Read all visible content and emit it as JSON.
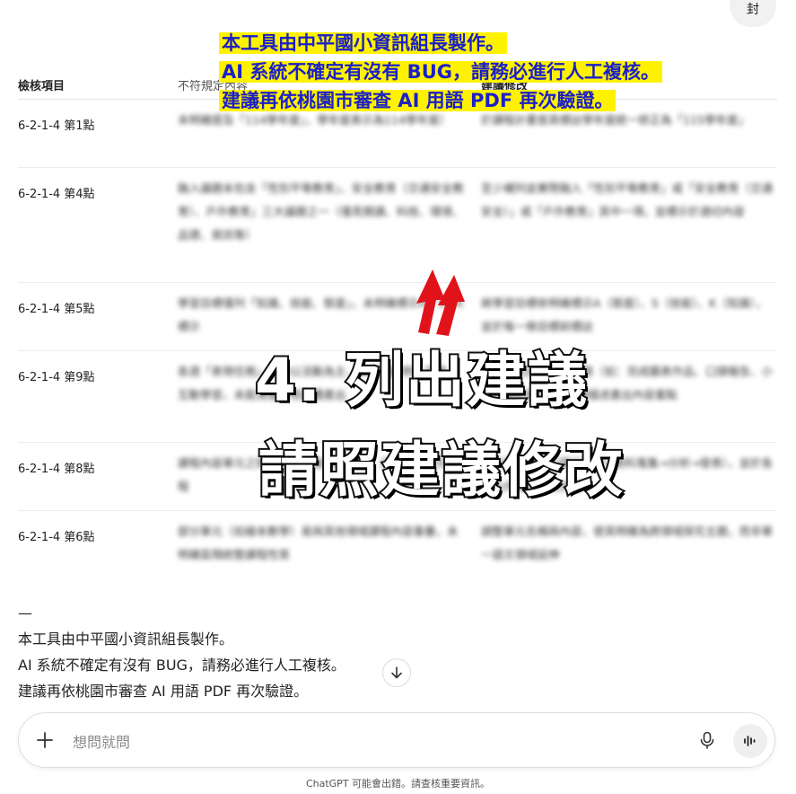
{
  "header": {
    "top_button_label": "封"
  },
  "table": {
    "headers": [
      "檢核項目",
      "不符規定內容",
      "建議修改"
    ],
    "rows": [
      {
        "item": "6-2-1-4 第1點",
        "issue": "未明確提及「114學年度」，學年度表示為114學年度）",
        "suggestion": "於課程計畫首頁標註學年度統一修正為「115學年度」"
      },
      {
        "item": "6-2-1-4 第4點",
        "issue": "融入議題未包含「性別平等教育」、安全教育（交通安全教育）、戶外教育」三大議題之一（僅見閱讀、科技、環境、品德、資訊等）",
        "suggestion": "至少補列並實際融入「性別平等教育」或「安全教育（交通安全）」或「戶外教育」其中一項，並標示於適切內容"
      },
      {
        "item": "6-2-1-4 第5點",
        "issue": "學習目標僅列「知識、技能、態度」，未明確標示A、S、K標示",
        "suggestion": "將學習目標依明確標示A（態度）、S（技能）、K（知識），並於每一條目標前標註"
      },
      {
        "item": "6-2-1-4 第9點",
        "issue": "各週「表現任務」描述以活動為主，未明確說明、評量、互動學習，未能清楚呈現具體產出",
        "suggestion": "每週補充具體表現任務（如：完成圖表作品、口頭報告、小組討論紀錄），並具體描述產出內容重點"
      },
      {
        "item": "6-2-1-4 第8點",
        "issue": "課程內容單元之間的探究歷程說明不足，未能呈現探究歷程",
        "suggestion": "補充探究歷程（提出問題→資料蒐集→分析→發表），並於各單元內標示探究步驟"
      },
      {
        "item": "6-2-1-4 第6點",
        "issue": "部分單元（如繪本數學）易與其他領域課程內容重疊，未明確區隔統整課程性質",
        "suggestion": "調整單元名稱與內容，使其明確為跨領域探究主題，而非單一語文領域延伸"
      }
    ]
  },
  "callout": {
    "lines": [
      "本工具由中平國小資訊組長製作。",
      "AI 系統不確定有沒有 BUG，請務必進行人工複核。",
      "建議再依桃園市審查 AI 用語 PDF 再次驗證。"
    ],
    "big_line1": "4. 列出建議",
    "big_line2": "請照建議修改"
  },
  "message": {
    "divider": "—",
    "lines": [
      "本工具由中平國小資訊組長製作。",
      "AI 系統不確定有沒有 BUG，請務必進行人工複核。",
      "建議再依桃園市審查 AI 用語 PDF 再次驗證。"
    ]
  },
  "composer": {
    "placeholder": "想問就問",
    "plus_icon": "plus-icon",
    "mic_icon": "microphone-icon",
    "voice_icon": "voice-mode-icon"
  },
  "disclaimer": "ChatGPT 可能會出錯。請查核重要資訊。",
  "colors": {
    "highlight": "#fff200",
    "callout_text": "#1c20c7",
    "arrow": "#e0131b"
  }
}
